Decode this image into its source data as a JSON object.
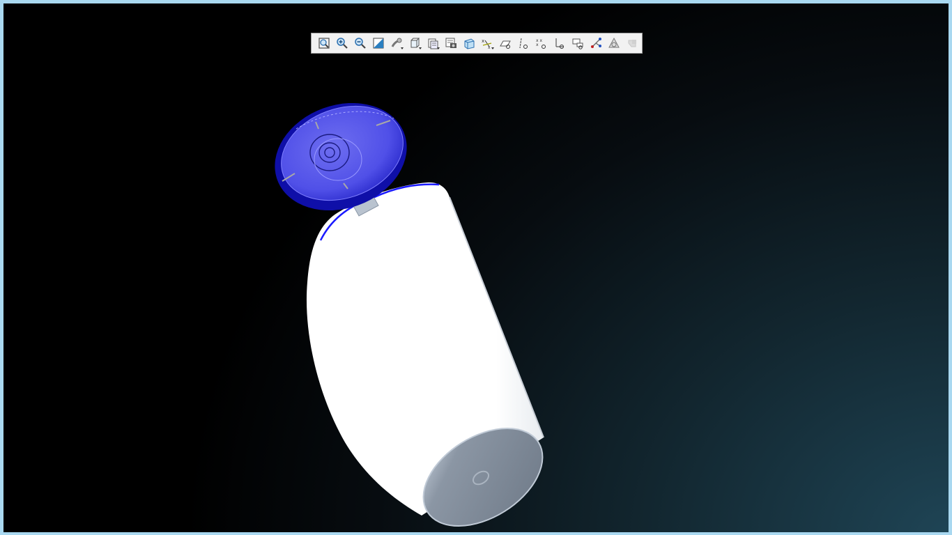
{
  "app": {
    "window_title": ""
  },
  "view_toolbar": {
    "buttons": [
      {
        "id": "refit",
        "icon": "zoom-fit-icon",
        "has_menu": false
      },
      {
        "id": "zoom-in",
        "icon": "zoom-in-icon",
        "has_menu": false
      },
      {
        "id": "zoom-out",
        "icon": "zoom-out-icon",
        "has_menu": false
      },
      {
        "id": "repaint",
        "icon": "repaint-icon",
        "has_menu": false
      },
      {
        "id": "reorient",
        "icon": "reorient-icon",
        "has_menu": true
      },
      {
        "id": "display-style",
        "icon": "display-style-icon",
        "has_menu": true
      },
      {
        "id": "saved-orientations",
        "icon": "saved-orientations-icon",
        "has_menu": true
      },
      {
        "id": "view-manager",
        "icon": "view-manager-icon",
        "has_menu": false
      },
      {
        "id": "perspective",
        "icon": "perspective-view-icon",
        "has_menu": false
      },
      {
        "id": "annotation-display",
        "icon": "annotation-display-icon",
        "has_menu": true
      },
      {
        "id": "plane-display",
        "icon": "plane-display-icon",
        "has_menu": false
      },
      {
        "id": "axis-display",
        "icon": "axis-display-icon",
        "has_menu": false
      },
      {
        "id": "point-display",
        "icon": "point-display-icon",
        "has_menu": false
      },
      {
        "id": "csys-display",
        "icon": "csys-display-icon",
        "has_menu": false
      },
      {
        "id": "annotation-toggle",
        "icon": "annotation-toggle-icon",
        "has_menu": false
      },
      {
        "id": "spin-center",
        "icon": "spin-center-icon",
        "has_menu": false
      },
      {
        "id": "simulation",
        "icon": "simulation-icon",
        "has_menu": false
      },
      {
        "id": "disabled-tool",
        "icon": "disabled-tool-icon",
        "has_menu": false,
        "disabled": true
      }
    ]
  },
  "colors": {
    "toolbar_bg": "#f2f2f2",
    "cap_blue": "#2b2bd6",
    "body_white": "#ffffff",
    "base_gray": "#7a8696",
    "highlight_edge": "#1a1aff"
  }
}
